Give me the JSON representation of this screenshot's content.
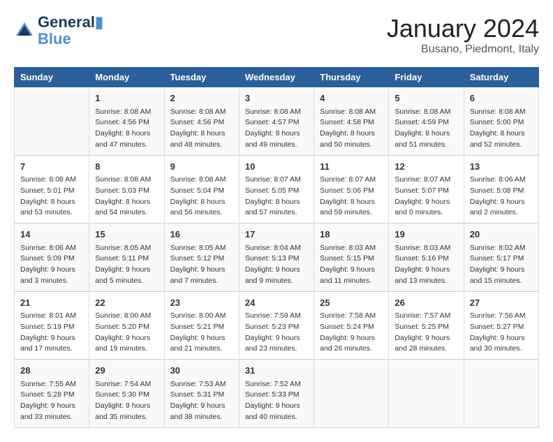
{
  "header": {
    "logo_line1": "General",
    "logo_line2": "Blue",
    "month": "January 2024",
    "location": "Busano, Piedmont, Italy"
  },
  "weekdays": [
    "Sunday",
    "Monday",
    "Tuesday",
    "Wednesday",
    "Thursday",
    "Friday",
    "Saturday"
  ],
  "weeks": [
    [
      {
        "day": "",
        "content": ""
      },
      {
        "day": "1",
        "content": "Sunrise: 8:08 AM\nSunset: 4:56 PM\nDaylight: 8 hours\nand 47 minutes."
      },
      {
        "day": "2",
        "content": "Sunrise: 8:08 AM\nSunset: 4:56 PM\nDaylight: 8 hours\nand 48 minutes."
      },
      {
        "day": "3",
        "content": "Sunrise: 8:08 AM\nSunset: 4:57 PM\nDaylight: 8 hours\nand 49 minutes."
      },
      {
        "day": "4",
        "content": "Sunrise: 8:08 AM\nSunset: 4:58 PM\nDaylight: 8 hours\nand 50 minutes."
      },
      {
        "day": "5",
        "content": "Sunrise: 8:08 AM\nSunset: 4:59 PM\nDaylight: 8 hours\nand 51 minutes."
      },
      {
        "day": "6",
        "content": "Sunrise: 8:08 AM\nSunset: 5:00 PM\nDaylight: 8 hours\nand 52 minutes."
      }
    ],
    [
      {
        "day": "7",
        "content": "Sunrise: 8:08 AM\nSunset: 5:01 PM\nDaylight: 8 hours\nand 53 minutes."
      },
      {
        "day": "8",
        "content": "Sunrise: 8:08 AM\nSunset: 5:03 PM\nDaylight: 8 hours\nand 54 minutes."
      },
      {
        "day": "9",
        "content": "Sunrise: 8:08 AM\nSunset: 5:04 PM\nDaylight: 8 hours\nand 56 minutes."
      },
      {
        "day": "10",
        "content": "Sunrise: 8:07 AM\nSunset: 5:05 PM\nDaylight: 8 hours\nand 57 minutes."
      },
      {
        "day": "11",
        "content": "Sunrise: 8:07 AM\nSunset: 5:06 PM\nDaylight: 8 hours\nand 59 minutes."
      },
      {
        "day": "12",
        "content": "Sunrise: 8:07 AM\nSunset: 5:07 PM\nDaylight: 9 hours\nand 0 minutes."
      },
      {
        "day": "13",
        "content": "Sunrise: 8:06 AM\nSunset: 5:08 PM\nDaylight: 9 hours\nand 2 minutes."
      }
    ],
    [
      {
        "day": "14",
        "content": "Sunrise: 8:06 AM\nSunset: 5:09 PM\nDaylight: 9 hours\nand 3 minutes."
      },
      {
        "day": "15",
        "content": "Sunrise: 8:05 AM\nSunset: 5:11 PM\nDaylight: 9 hours\nand 5 minutes."
      },
      {
        "day": "16",
        "content": "Sunrise: 8:05 AM\nSunset: 5:12 PM\nDaylight: 9 hours\nand 7 minutes."
      },
      {
        "day": "17",
        "content": "Sunrise: 8:04 AM\nSunset: 5:13 PM\nDaylight: 9 hours\nand 9 minutes."
      },
      {
        "day": "18",
        "content": "Sunrise: 8:03 AM\nSunset: 5:15 PM\nDaylight: 9 hours\nand 11 minutes."
      },
      {
        "day": "19",
        "content": "Sunrise: 8:03 AM\nSunset: 5:16 PM\nDaylight: 9 hours\nand 13 minutes."
      },
      {
        "day": "20",
        "content": "Sunrise: 8:02 AM\nSunset: 5:17 PM\nDaylight: 9 hours\nand 15 minutes."
      }
    ],
    [
      {
        "day": "21",
        "content": "Sunrise: 8:01 AM\nSunset: 5:19 PM\nDaylight: 9 hours\nand 17 minutes."
      },
      {
        "day": "22",
        "content": "Sunrise: 8:00 AM\nSunset: 5:20 PM\nDaylight: 9 hours\nand 19 minutes."
      },
      {
        "day": "23",
        "content": "Sunrise: 8:00 AM\nSunset: 5:21 PM\nDaylight: 9 hours\nand 21 minutes."
      },
      {
        "day": "24",
        "content": "Sunrise: 7:59 AM\nSunset: 5:23 PM\nDaylight: 9 hours\nand 23 minutes."
      },
      {
        "day": "25",
        "content": "Sunrise: 7:58 AM\nSunset: 5:24 PM\nDaylight: 9 hours\nand 26 minutes."
      },
      {
        "day": "26",
        "content": "Sunrise: 7:57 AM\nSunset: 5:25 PM\nDaylight: 9 hours\nand 28 minutes."
      },
      {
        "day": "27",
        "content": "Sunrise: 7:56 AM\nSunset: 5:27 PM\nDaylight: 9 hours\nand 30 minutes."
      }
    ],
    [
      {
        "day": "28",
        "content": "Sunrise: 7:55 AM\nSunset: 5:28 PM\nDaylight: 9 hours\nand 33 minutes."
      },
      {
        "day": "29",
        "content": "Sunrise: 7:54 AM\nSunset: 5:30 PM\nDaylight: 9 hours\nand 35 minutes."
      },
      {
        "day": "30",
        "content": "Sunrise: 7:53 AM\nSunset: 5:31 PM\nDaylight: 9 hours\nand 38 minutes."
      },
      {
        "day": "31",
        "content": "Sunrise: 7:52 AM\nSunset: 5:33 PM\nDaylight: 9 hours\nand 40 minutes."
      },
      {
        "day": "",
        "content": ""
      },
      {
        "day": "",
        "content": ""
      },
      {
        "day": "",
        "content": ""
      }
    ]
  ]
}
